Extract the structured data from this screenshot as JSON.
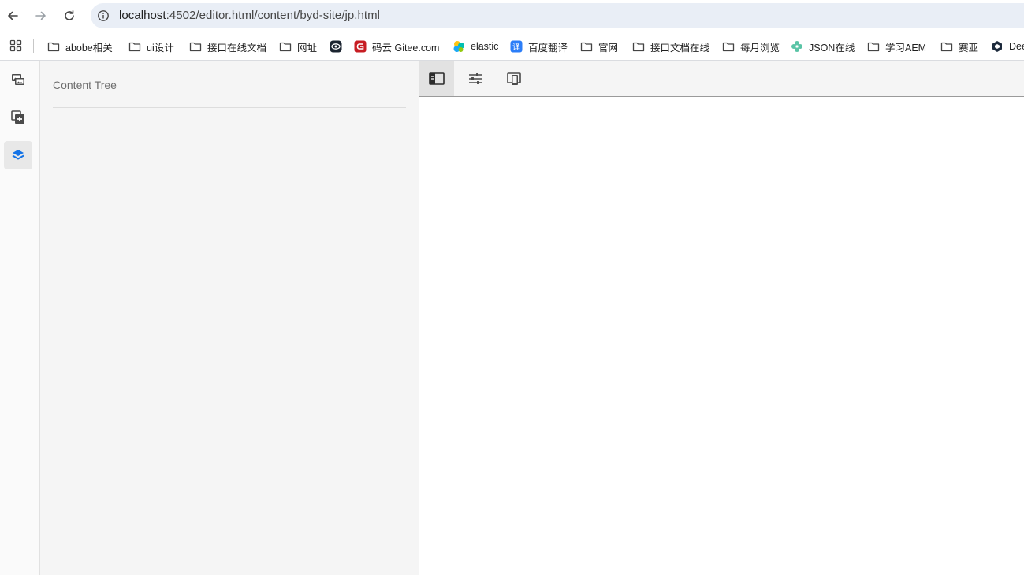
{
  "browser": {
    "url_host": "localhost",
    "url_path": ":4502/editor.html/content/byd-site/jp.html",
    "bookmarks": [
      {
        "label": "abobe相关",
        "icon": "folder-icon"
      },
      {
        "label": "ui设计",
        "icon": "folder-icon"
      },
      {
        "label": "接口在线文档",
        "icon": "folder-icon"
      },
      {
        "label": "网址",
        "icon": "folder-icon"
      },
      {
        "label": "",
        "icon": "eye-logo-icon"
      },
      {
        "label": "码云 Gitee.com",
        "icon": "gitee-logo-icon"
      },
      {
        "label": "elastic",
        "icon": "elastic-logo-icon"
      },
      {
        "label": "百度翻译",
        "icon": "translate-logo-icon"
      },
      {
        "label": "官网",
        "icon": "folder-icon"
      },
      {
        "label": "接口文档在线",
        "icon": "folder-icon"
      },
      {
        "label": "每月浏览",
        "icon": "folder-icon"
      },
      {
        "label": "JSON在线",
        "icon": "json-logo-icon"
      },
      {
        "label": "学习AEM",
        "icon": "folder-icon"
      },
      {
        "label": "赛亚",
        "icon": "folder-icon"
      },
      {
        "label": "Dee",
        "icon": "deepseek-logo-icon"
      }
    ]
  },
  "sidebar": {
    "panel_title": "Content Tree"
  },
  "colors": {
    "accent": "#1473e6",
    "gitee": "#c71d23",
    "elastic": "#00bfb3",
    "json": "#5ac4a6"
  }
}
